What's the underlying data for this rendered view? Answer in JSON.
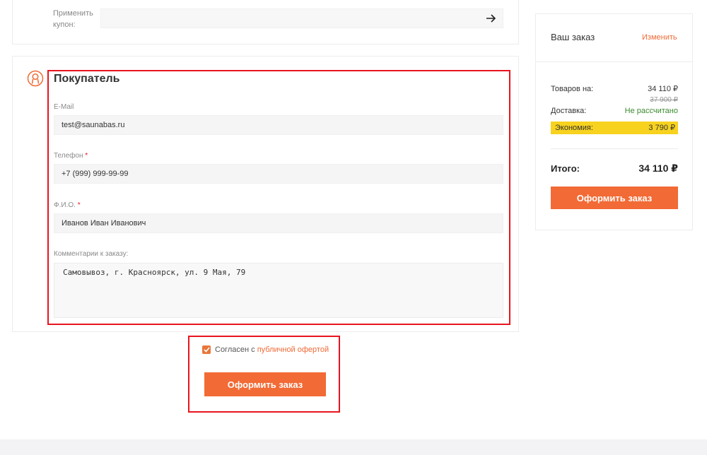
{
  "coupon": {
    "label": "Применить купон:",
    "input_value": "",
    "submit_icon": "arrow-right-icon"
  },
  "buyer": {
    "title": "Покупатель",
    "icon": "user-icon",
    "email": {
      "label": "E-Mail",
      "value": "test@saunabas.ru"
    },
    "phone": {
      "label": "Телефон",
      "required_mark": "*",
      "value": "+7 (999) 999-99-99"
    },
    "fio": {
      "label": "Ф.И.О.",
      "required_mark": "*",
      "value": "Иванов Иван Иванович"
    },
    "comment": {
      "label": "Комментарии к заказу:",
      "value": "Самовывоз, г. Красноярск, ул. 9 Мая, 79"
    }
  },
  "agreement": {
    "checked": true,
    "text": "Согласен с",
    "link_text": "публичной офертой",
    "button_label": "Оформить заказ"
  },
  "order": {
    "title": "Ваш заказ",
    "change_label": "Изменить",
    "goods_label": "Товаров на:",
    "goods_value": "34 110 ₽",
    "goods_old_value": "37 900 ₽",
    "delivery_label": "Доставка:",
    "delivery_value": "Не рассчитано",
    "economy_label": "Экономия:",
    "economy_value": "3 790 ₽",
    "total_label": "Итого:",
    "total_value": "34 110 ₽",
    "button_label": "Оформить заказ"
  },
  "colors": {
    "accent": "#f26a35",
    "highlight_frame": "#e8141f",
    "economy_bg": "#f7d21f",
    "delivery_text": "#3a8a2e"
  }
}
